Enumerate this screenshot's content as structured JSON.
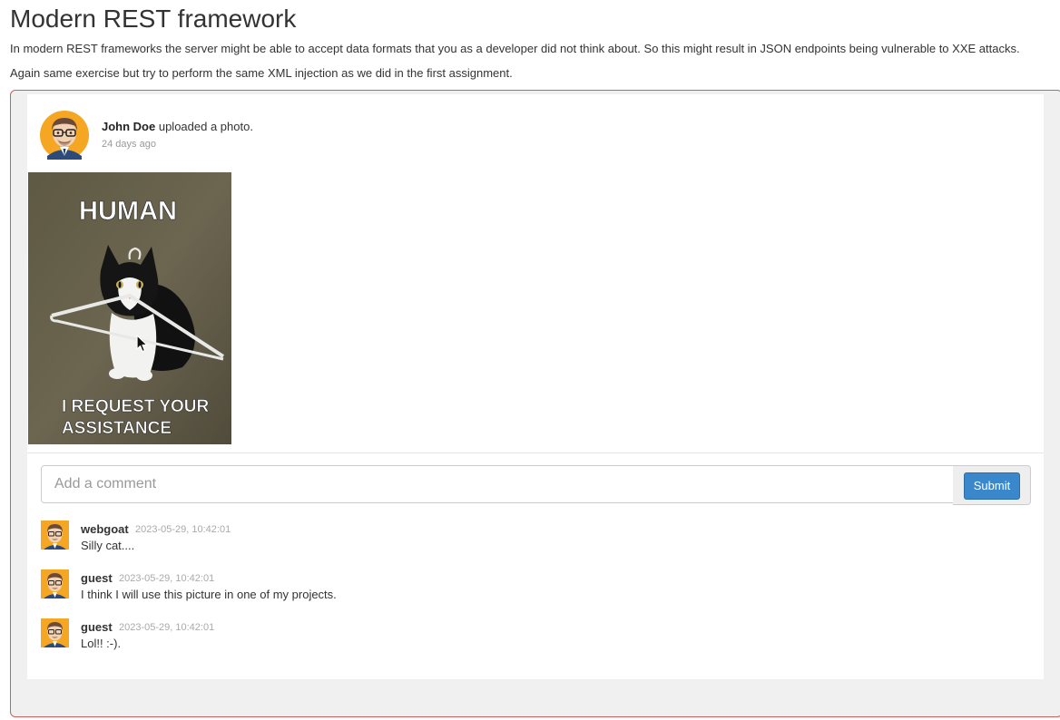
{
  "page": {
    "title": "Modern REST framework",
    "intro_1": "In modern REST frameworks the server might be able to accept data formats that you as a developer did not think about. So this might result in JSON endpoints being vulnerable to XXE attacks.",
    "intro_2": "Again same exercise but try to perform the same XML injection as we did in the first assignment."
  },
  "post": {
    "author": "John Doe",
    "action": " uploaded a photo.",
    "time": "24 days ago",
    "photo": {
      "top_text": "HUMAN",
      "bottom_text_1": "I REQUEST YOUR",
      "bottom_text_2": "ASSISTANCE"
    }
  },
  "comment_form": {
    "placeholder": "Add a comment",
    "value": "",
    "submit_label": "Submit"
  },
  "comments": [
    {
      "user": "webgoat",
      "time": "2023-05-29, 10:42:01",
      "text": "Silly cat...."
    },
    {
      "user": "guest",
      "time": "2023-05-29, 10:42:01",
      "text": "I think I will use this picture in one of my projects."
    },
    {
      "user": "guest",
      "time": "2023-05-29, 10:42:01",
      "text": "Lol!! :-)."
    }
  ],
  "colors": {
    "accent": "#3a87cc",
    "container_border": "#c9605a",
    "container_bg": "#f0f0f0",
    "avatar_bg": "#f5a623"
  }
}
